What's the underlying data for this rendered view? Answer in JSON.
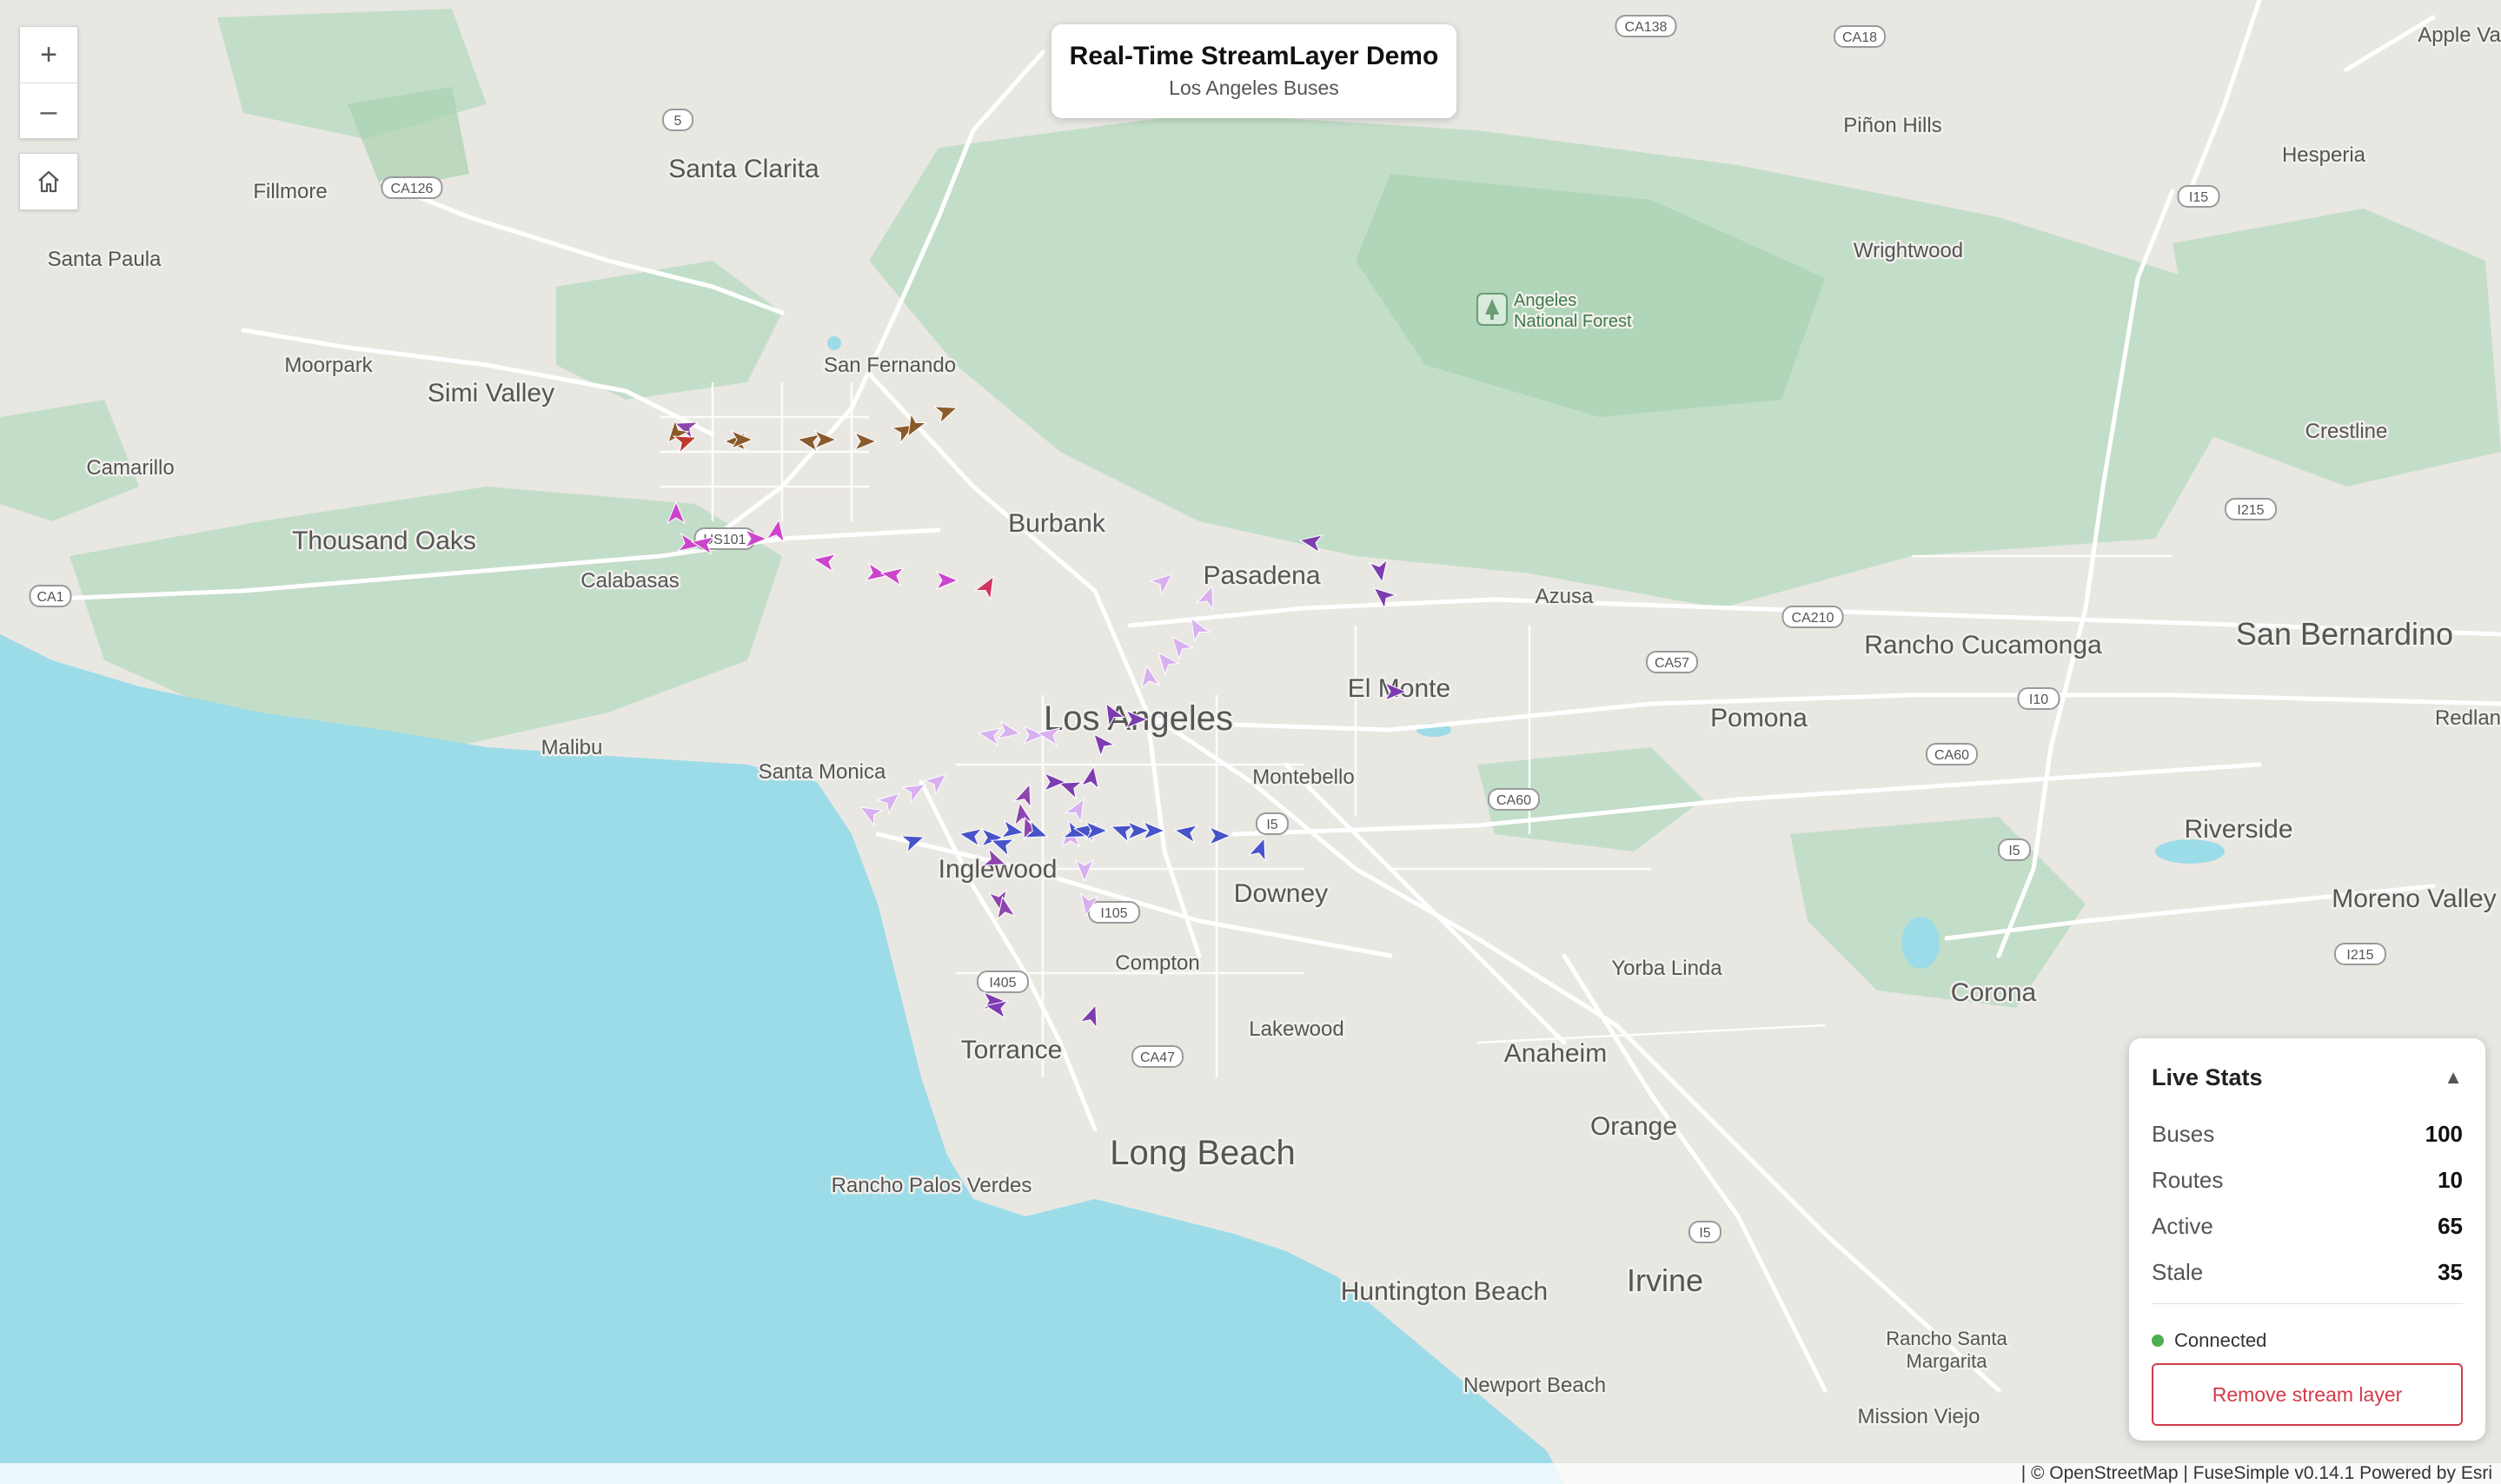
{
  "controls": {
    "zoom_in": "+",
    "zoom_out": "–",
    "zoom_in_icon": "plus-icon",
    "zoom_out_icon": "minus-icon",
    "home_icon": "home-icon"
  },
  "title_card": {
    "title": "Real-Time StreamLayer Demo",
    "subtitle": "Los Angeles Buses"
  },
  "live_stats": {
    "title": "Live Stats",
    "collapse_glyph": "▲",
    "rows": [
      {
        "label": "Buses",
        "value": "100"
      },
      {
        "label": "Routes",
        "value": "10"
      },
      {
        "label": "Active",
        "value": "65"
      },
      {
        "label": "Stale",
        "value": "35"
      }
    ],
    "status": "Connected",
    "status_color": "#4caf50",
    "remove_button": "Remove stream layer",
    "button_color": "#d33a4a"
  },
  "attribution": "| © OpenStreetMap | FuseSimple v0.14.1   Powered by Esri",
  "map": {
    "water_color": "#9cdce8",
    "land_color": "#e9e7e2",
    "forest_color": "#bfdcc4",
    "place_labels": {
      "santa_clarita": "Santa Clarita",
      "fillmore": "Fillmore",
      "santa_paula": "Santa Paula",
      "moorpark": "Moorpark",
      "simi_valley": "Simi Valley",
      "san_fernando": "San Fernando",
      "camarillo": "Camarillo",
      "thousand_oaks": "Thousand Oaks",
      "calabasas": "Calabasas",
      "burbank": "Burbank",
      "pasadena": "Pasadena",
      "malibu": "Malibu",
      "santa_monica": "Santa Monica",
      "los_angeles": "Los Angeles",
      "el_monte": "El Monte",
      "azusa": "Azusa",
      "montebello": "Montebello",
      "inglewood": "Inglewood",
      "downey": "Downey",
      "compton": "Compton",
      "torrance": "Torrance",
      "lakewood": "Lakewood",
      "long_beach": "Long Beach",
      "rancho_palos_verdes": "Rancho Palos Verdes",
      "anaheim": "Anaheim",
      "orange": "Orange",
      "yorba_linda": "Yorba Linda",
      "pomona": "Pomona",
      "rancho_cucamonga": "Rancho Cucamonga",
      "san_bernardino": "San Bernardino",
      "riverside": "Riverside",
      "corona": "Corona",
      "moreno_valley": "Moreno Valley",
      "redlands": "Redlan",
      "hesperia": "Hesperia",
      "pinon_hills": "Piñon Hills",
      "wrightwood": "Wrightwood",
      "crestline": "Crestline",
      "apple_valley": "Apple Va",
      "huntington_beach": "Huntington Beach",
      "irvine": "Irvine",
      "newport_beach": "Newport Beach",
      "mission_viejo": "Mission Viejo",
      "rancho_santa_margarita_1": "Rancho Santa",
      "rancho_santa_margarita_2": "Margarita",
      "forest_1": "Angeles",
      "forest_2": "National Forest"
    },
    "shields": {
      "ca138": "CA138",
      "ca18": "CA18",
      "i5_north": "5",
      "ca126": "CA126",
      "us101": "US101",
      "ca1": "CA1",
      "i15_north": "I15",
      "i215_north": "I215",
      "ca210": "CA210",
      "ca57": "CA57",
      "i10": "I10",
      "ca60_west": "CA60",
      "ca60_east": "CA60",
      "i5_mid": "I5",
      "i105": "I105",
      "i405": "I405",
      "ca47": "CA47",
      "i15_mid": "I5",
      "i215_south": "I215",
      "i5_south": "I5"
    }
  }
}
